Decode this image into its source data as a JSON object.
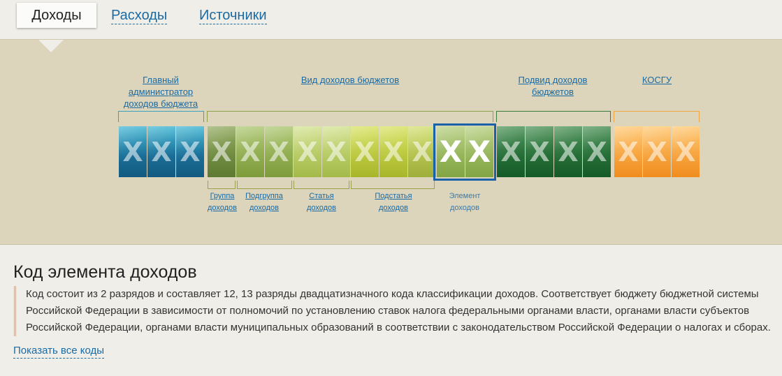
{
  "tabs": {
    "active": "Доходы",
    "items": [
      "Расходы",
      "Источники"
    ]
  },
  "groups": {
    "admin": "Главный администратор доходов бюджета",
    "vid": "Вид доходов бюджетов",
    "podvid": "Подвид доходов бюджетов",
    "kosgu": "КОСГУ"
  },
  "subgroups": {
    "gruppa": "Группа доходов",
    "podgruppa": "Подгруппа доходов",
    "statya": "Статья доходов",
    "podstatya": "Подстатья доходов",
    "element": "Элемент доходов"
  },
  "tile_glyph": "X",
  "colors": {
    "admin": "#1f7e9e",
    "gruppa": "#6e8a3e",
    "podgruppa": "#90ad4a",
    "statya": "#b4c95a",
    "podstatya": "#bccd3a",
    "element": "#8fb14e",
    "podvid": "#1f6a34",
    "kosgu": "#f29a2e",
    "selection": "#1a62a8",
    "link": "#1a6aa4"
  },
  "content": {
    "heading": "Код элемента доходов",
    "description": "Код состоит из 2 разрядов и составляет 12, 13 разряды двадцатизначного кода классификации доходов. Соответствует бюджету бюджетной системы Российской Федерации в зависимости от полномочий по установлению ставок налога федеральными органами власти, органами власти субъектов Российской Федерации, органами власти муниципальных образований в соответствии с законодательством Российской Федерации о налогах и сборах.",
    "show_all": "Показать все коды"
  }
}
